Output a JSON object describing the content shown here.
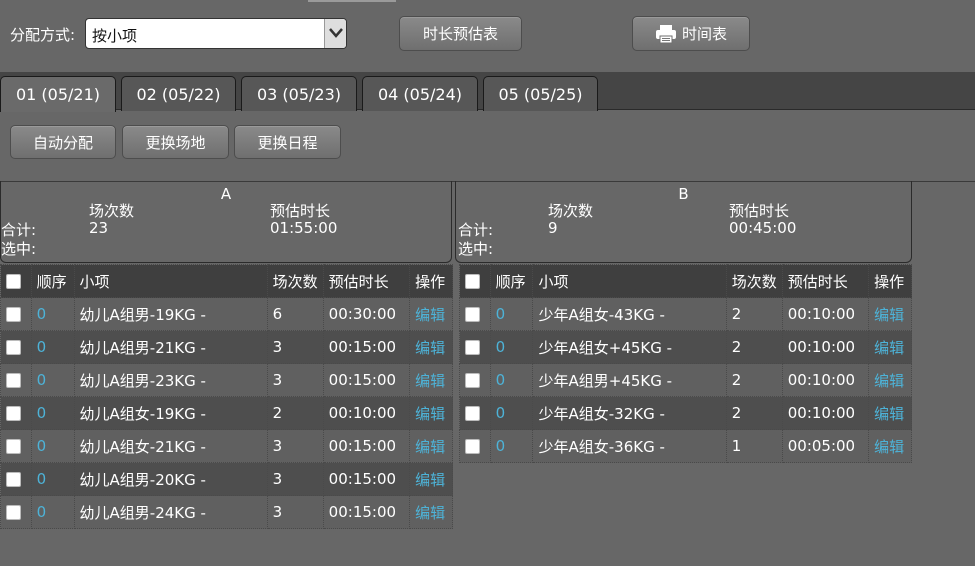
{
  "toolbar": {
    "label": "分配方式:",
    "select_value": "按小项",
    "estimate_button": "时长预估表",
    "schedule_button": "时间表"
  },
  "tabs": [
    "01 (05/21)",
    "02 (05/22)",
    "03 (05/23)",
    "04 (05/24)",
    "05 (05/25)"
  ],
  "actions": {
    "auto": "自动分配",
    "venue": "更换场地",
    "schedule": "更换日程"
  },
  "venues": [
    {
      "name": "A",
      "count_label": "场次数",
      "duration_label": "预估时长",
      "total_label": "合计:",
      "selected_label": "选中:",
      "total_count": "23",
      "total_duration": "01:55:00"
    },
    {
      "name": "B",
      "count_label": "场次数",
      "duration_label": "预估时长",
      "total_label": "合计:",
      "selected_label": "选中:",
      "total_count": "9",
      "total_duration": "00:45:00"
    }
  ],
  "table_headers": [
    "顺序",
    "小项",
    "场次数",
    "预估时长",
    "操作"
  ],
  "edit_label": "编辑",
  "rows_a": [
    {
      "seq": "0",
      "item": "幼儿A组男-19KG -",
      "count": "6",
      "duration": "00:30:00"
    },
    {
      "seq": "0",
      "item": "幼儿A组男-21KG -",
      "count": "3",
      "duration": "00:15:00"
    },
    {
      "seq": "0",
      "item": "幼儿A组男-23KG -",
      "count": "3",
      "duration": "00:15:00"
    },
    {
      "seq": "0",
      "item": "幼儿A组女-19KG -",
      "count": "2",
      "duration": "00:10:00"
    },
    {
      "seq": "0",
      "item": "幼儿A组女-21KG -",
      "count": "3",
      "duration": "00:15:00"
    },
    {
      "seq": "0",
      "item": "幼儿A组男-20KG -",
      "count": "3",
      "duration": "00:15:00"
    },
    {
      "seq": "0",
      "item": "幼儿A组男-24KG -",
      "count": "3",
      "duration": "00:15:00"
    }
  ],
  "rows_b": [
    {
      "seq": "0",
      "item": "少年A组女-43KG -",
      "count": "2",
      "duration": "00:10:00"
    },
    {
      "seq": "0",
      "item": "少年A组女+45KG -",
      "count": "2",
      "duration": "00:10:00"
    },
    {
      "seq": "0",
      "item": "少年A组男+45KG -",
      "count": "2",
      "duration": "00:10:00"
    },
    {
      "seq": "0",
      "item": "少年A组女-32KG -",
      "count": "2",
      "duration": "00:10:00"
    },
    {
      "seq": "0",
      "item": "少年A组女-36KG -",
      "count": "1",
      "duration": "00:05:00"
    }
  ]
}
